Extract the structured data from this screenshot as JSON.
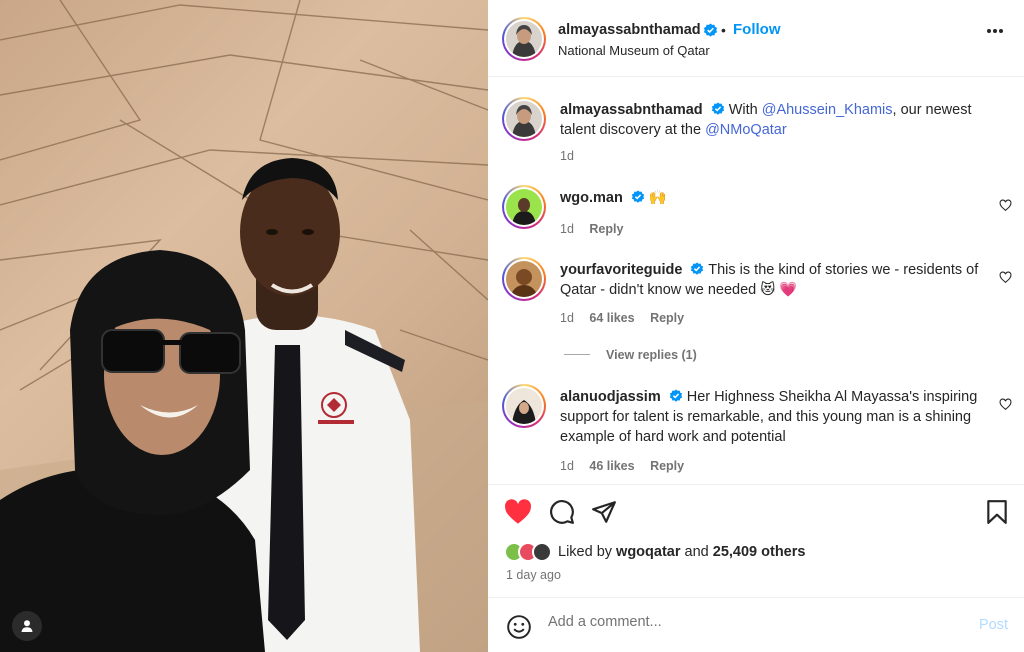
{
  "post": {
    "author": "almayassabnthamad",
    "follow_label": "Follow",
    "dot": "•",
    "location": "National Museum of Qatar",
    "more_icon": "more-horizontal-icon"
  },
  "caption": {
    "username": "almayassabnthamad",
    "text_before": "With ",
    "mention1": "@Ahussein_Khamis",
    "text_middle": ", our newest talent discovery at the ",
    "mention2": "@NMoQatar",
    "time": "1d"
  },
  "comments": [
    {
      "username": "wgo.man",
      "text": "🙌",
      "time": "1d",
      "likes": "",
      "reply": "Reply"
    },
    {
      "username": "yourfavoriteguide",
      "text": "This is the kind of stories we - residents of Qatar - didn't know we needed 😻 💗",
      "time": "1d",
      "likes": "64 likes",
      "reply": "Reply"
    },
    {
      "username": "alanuodjassim",
      "text": "Her Highness Sheikha Al Mayassa's inspiring support for talent is remarkable, and this young man is a shining example of hard work and potential",
      "time": "1d",
      "likes": "46 likes",
      "reply": "Reply"
    }
  ],
  "view_replies": "View replies (1)",
  "likes": {
    "prefix": "Liked by ",
    "user": "wgoqatar",
    "middle": " and ",
    "count": "25,409 others"
  },
  "time_ago": "1 day ago",
  "comment_box": {
    "placeholder": "Add a comment...",
    "post_label": "Post"
  },
  "colors": {
    "like_red": "#ff3040",
    "link_blue": "#0095f6",
    "verified_blue": "#0095f6"
  }
}
